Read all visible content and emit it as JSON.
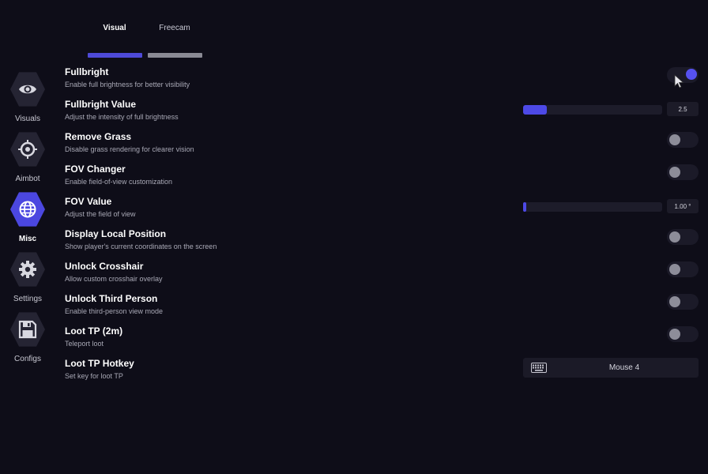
{
  "tabs": [
    {
      "label": "Visual",
      "active": true,
      "bar_color": "#4e4ad8"
    },
    {
      "label": "Freecam",
      "active": false,
      "bar_color": "#8a8a94"
    }
  ],
  "sidebar": {
    "items": [
      {
        "label": "Visuals",
        "icon": "eye-icon",
        "active": false
      },
      {
        "label": "Aimbot",
        "icon": "crosshair-icon",
        "active": false
      },
      {
        "label": "Misc",
        "icon": "globe-icon",
        "active": true
      },
      {
        "label": "Settings",
        "icon": "gear-icon",
        "active": false
      },
      {
        "label": "Configs",
        "icon": "floppy-disk-icon",
        "active": false
      }
    ]
  },
  "settings": [
    {
      "title": "Fullbright",
      "desc": "Enable full brightness for better visibility",
      "control": "toggle",
      "on": true
    },
    {
      "title": "Fullbright Value",
      "desc": "Adjust the intensity of full brightness",
      "control": "slider",
      "value": "2.5",
      "fill_fraction": 0.17
    },
    {
      "title": "Remove Grass",
      "desc": "Disable grass rendering for clearer vision",
      "control": "toggle",
      "on": false
    },
    {
      "title": "FOV Changer",
      "desc": "Enable field-of-view customization",
      "control": "toggle",
      "on": false
    },
    {
      "title": "FOV Value",
      "desc": "Adjust the field of view",
      "control": "slider",
      "value": "1.00 °",
      "fill_fraction": 0.02
    },
    {
      "title": "Display Local Position",
      "desc": "Show player's current coordinates on the screen",
      "control": "toggle",
      "on": false
    },
    {
      "title": "Unlock Crosshair",
      "desc": "Allow custom crosshair overlay",
      "control": "toggle",
      "on": false
    },
    {
      "title": "Unlock Third Person",
      "desc": "Enable third-person view mode",
      "control": "toggle",
      "on": false
    },
    {
      "title": "Loot TP (2m)",
      "desc": "Teleport loot",
      "control": "toggle",
      "on": false
    },
    {
      "title": "Loot TP Hotkey",
      "desc": "Set key for loot TP",
      "control": "keybind",
      "value": "Mouse 4",
      "icon": "keyboard-icon"
    }
  ],
  "colors": {
    "accent": "#4b47e0",
    "background": "#0e0d18"
  }
}
